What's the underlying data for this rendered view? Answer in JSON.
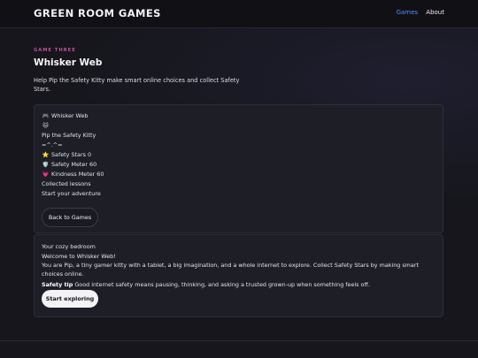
{
  "header": {
    "brand": "GREEN ROOM GAMES",
    "nav": [
      {
        "label": "Games",
        "active": true
      },
      {
        "label": "About",
        "active": false
      }
    ]
  },
  "hero": {
    "eyebrow": "GAME THREE",
    "title": "Whisker Web",
    "description": "Help Pip the Safety Kitty make smart online choices and collect Safety Stars."
  },
  "status_card": {
    "game_name": "Whisker Web",
    "game_icon": "🎮",
    "cat_icon": "🐱",
    "character_name": "Pip the Safety Kitty",
    "character_face": "=^.^=",
    "safety_stars_icon": "⭐",
    "safety_stars": "Safety Stars 0",
    "safety_meter_icon": "🛡️",
    "safety_meter": "Safety Meter 60",
    "kindness_meter_icon": "💗",
    "kindness_meter": "Kindness Meter 60",
    "collected_lessons": "Collected lessons",
    "start_adventure": "Start your adventure",
    "back_button": "Back to Games"
  },
  "story_card": {
    "location": "Your cozy bedroom",
    "welcome": "Welcome to Whisker Web!",
    "intro": "You are Pip, a tiny gamer kitty with a tablet, a big imagination, and a whole internet to explore. Collect Safety Stars by making smart choices online.",
    "tip_label": "Safety tip",
    "tip_text": "Good internet safety means pausing, thinking, and asking a trusted grown-up when something feels off.",
    "start_button": "Start exploring"
  },
  "colors": {
    "background": "#16161c",
    "nav_active": "#4d8df7",
    "eyebrow": "#c0509a"
  }
}
